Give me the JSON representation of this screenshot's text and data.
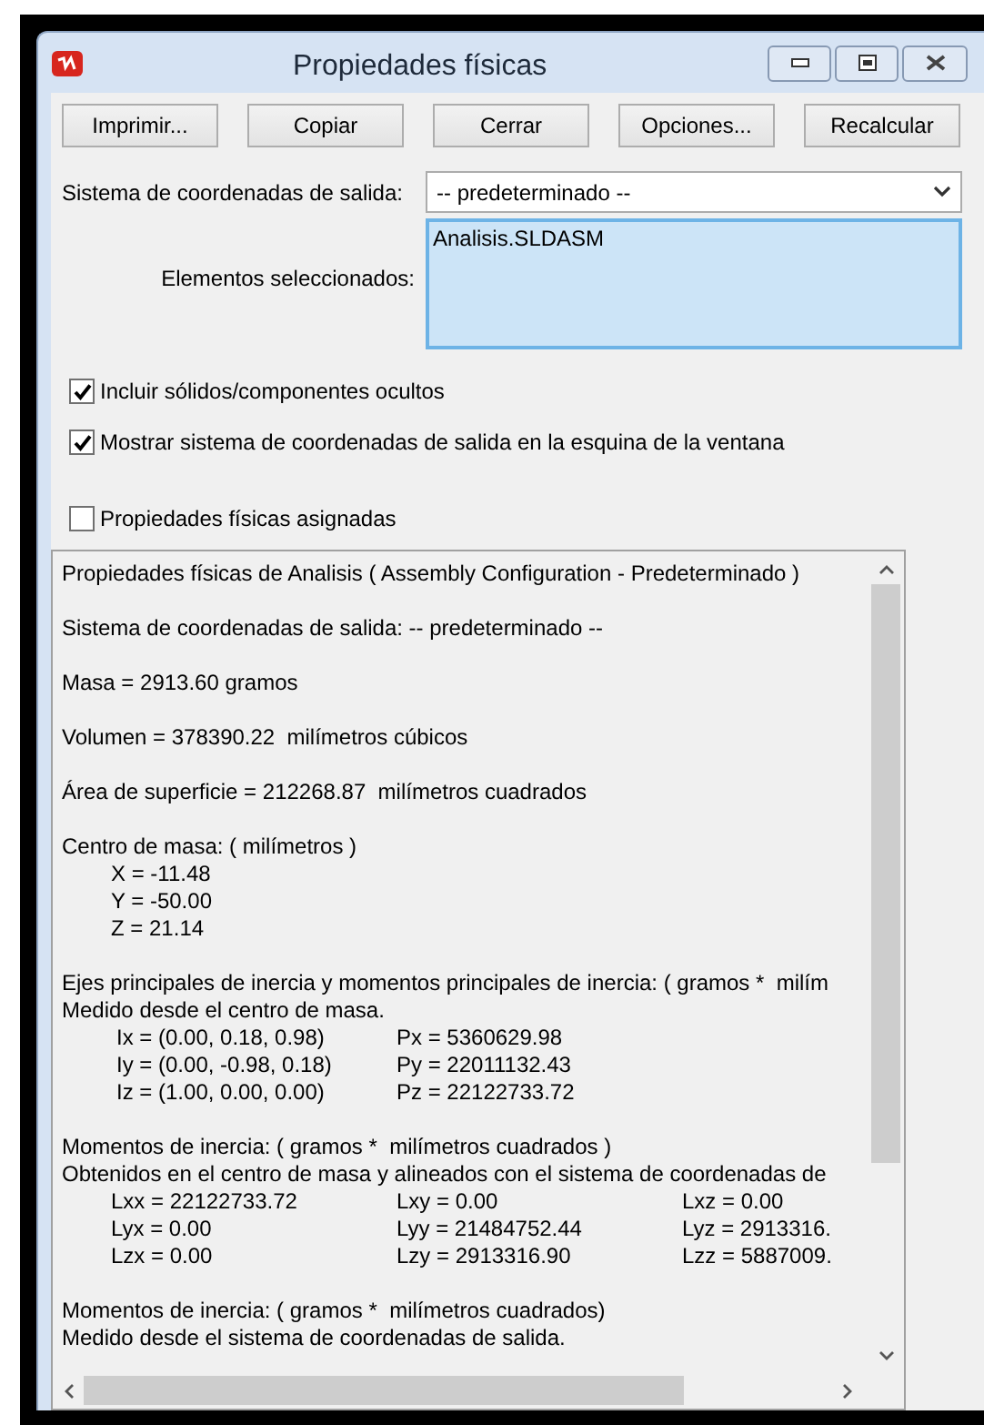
{
  "window": {
    "title": "Propiedades físicas"
  },
  "buttons": [
    "Imprimir...",
    "Copiar",
    "Cerrar",
    "Opciones...",
    "Recalcular"
  ],
  "output_coordinate_system": {
    "label": "Sistema de coordenadas de salida:",
    "value": "-- predeterminado --"
  },
  "selected_items": {
    "label": "Elementos seleccionados:",
    "items": [
      "Analisis.SLDASM"
    ]
  },
  "options": [
    {
      "label": "Incluir sólidos/componentes ocultos",
      "checked": true
    },
    {
      "label": "Mostrar sistema de coordenadas de salida en la esquina de la ventana",
      "checked": true
    }
  ],
  "assigned": {
    "label": "Propiedades físicas asignadas",
    "checked": false
  },
  "results": [
    {
      "lines": [
        {
          "kind": "text",
          "text": "Propiedades físicas de Analisis ( Assembly Configuration - Predeterminado )"
        }
      ]
    },
    {
      "lines": [
        {
          "kind": "text",
          "text": "Sistema de coordenadas de salida: -- predeterminado --"
        }
      ]
    },
    {
      "lines": [
        {
          "kind": "text",
          "text": "Masa = 2913.60 gramos"
        }
      ]
    },
    {
      "lines": [
        {
          "kind": "text",
          "text": "Volumen = 378390.22  milímetros cúbicos"
        }
      ]
    },
    {
      "lines": [
        {
          "kind": "text",
          "text": "Área de superficie = 212268.87  milímetros cuadrados"
        }
      ]
    },
    {
      "lines": [
        {
          "kind": "text",
          "text": "Centro de masa: ( milímetros )"
        },
        {
          "kind": "row",
          "cells": [
            "X = -11.48"
          ]
        },
        {
          "kind": "row",
          "cells": [
            "Y = -50.00"
          ]
        },
        {
          "kind": "row",
          "cells": [
            "Z = 21.14"
          ]
        }
      ]
    },
    {
      "lines": [
        {
          "kind": "text",
          "text": "Ejes principales de inercia y momentos principales de inercia: ( gramos *  milím"
        },
        {
          "kind": "text",
          "text": "Medido desde el centro de masa."
        },
        {
          "kind": "axes",
          "cells": [
            "Ix = (0.00, 0.18, 0.98)",
            "Px = 5360629.98"
          ]
        },
        {
          "kind": "axes",
          "cells": [
            "Iy = (0.00, -0.98, 0.18)",
            "Py = 22011132.43"
          ]
        },
        {
          "kind": "axes",
          "cells": [
            "Iz = (1.00, 0.00, 0.00)",
            "Pz = 22122733.72"
          ]
        }
      ]
    },
    {
      "lines": [
        {
          "kind": "text",
          "text": "Momentos de inercia: ( gramos *  milímetros cuadrados )"
        },
        {
          "kind": "text",
          "text": "Obtenidos en el centro de masa y alineados con el sistema de coordenadas de"
        },
        {
          "kind": "row",
          "cells": [
            "Lxx = 22122733.72",
            "Lxy = 0.00",
            "Lxz = 0.00"
          ]
        },
        {
          "kind": "row",
          "cells": [
            "Lyx = 0.00",
            "Lyy = 21484752.44",
            "Lyz = 2913316."
          ]
        },
        {
          "kind": "row",
          "cells": [
            "Lzx = 0.00",
            "Lzy = 2913316.90",
            "Lzz = 5887009."
          ]
        }
      ]
    },
    {
      "lines": [
        {
          "kind": "text",
          "text": "Momentos de inercia: ( gramos *  milímetros cuadrados)"
        },
        {
          "kind": "text",
          "text": "Medido desde el sistema de coordenadas de salida."
        }
      ]
    }
  ]
}
